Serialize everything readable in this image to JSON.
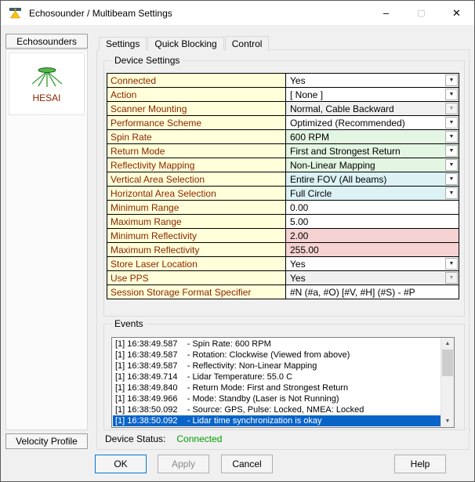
{
  "palette": {
    "accent": "#0078D7",
    "label_bg": "#FFFFD9",
    "label_text": "#8B2500",
    "green_bg": "#E3F5E3",
    "cyan_bg": "#DCF2F5",
    "pink_bg": "#F6D2D2",
    "disabled_bg": "#F0F0F0",
    "white_bg": "#FFFFFF",
    "selection_bg": "#0A64C8",
    "status_color": "#00A000",
    "grid_border": "#000000"
  },
  "window": {
    "title": "Echosounder / Multibeam Settings",
    "minimize_glyph": "–",
    "maximize_glyph": "▢",
    "close_glyph": "✕"
  },
  "sidebar": {
    "header": "Echosounders",
    "device": "HESAI",
    "footer": "Velocity Profile"
  },
  "tabs": [
    {
      "label": "Settings",
      "active": false
    },
    {
      "label": "Quick Blocking",
      "active": false
    },
    {
      "label": "Control",
      "active": true
    }
  ],
  "device_settings": {
    "title": "Device Settings",
    "rows": [
      {
        "label": "Connected",
        "value": "Yes",
        "control": "dropdown",
        "bg": "white",
        "disabled": false
      },
      {
        "label": "Action",
        "value": "[ None ]",
        "control": "dropdown",
        "bg": "white",
        "disabled": false
      },
      {
        "label": "Scanner Mounting",
        "value": "Normal, Cable Backward",
        "control": "dropdown",
        "bg": "disabled",
        "disabled": true
      },
      {
        "label": "Performance Scheme",
        "value": "Optimized (Recommended)",
        "control": "dropdown",
        "bg": "white",
        "disabled": false
      },
      {
        "label": "Spin Rate",
        "value": "600 RPM",
        "control": "dropdown",
        "bg": "green",
        "disabled": false
      },
      {
        "label": "Return Mode",
        "value": "First and Strongest Return",
        "control": "dropdown",
        "bg": "green",
        "disabled": false
      },
      {
        "label": "Reflectivity Mapping",
        "value": "Non-Linear Mapping",
        "control": "dropdown",
        "bg": "green",
        "disabled": false
      },
      {
        "label": "Vertical Area Selection",
        "value": "Entire FOV (All beams)",
        "control": "dropdown",
        "bg": "cyan",
        "disabled": false
      },
      {
        "label": "Horizontal Area Selection",
        "value": "Full Circle",
        "control": "dropdown",
        "bg": "cyan",
        "disabled": false
      },
      {
        "label": "Minimum Range",
        "value": "0.00",
        "control": "input",
        "bg": "white",
        "disabled": false
      },
      {
        "label": "Maximum Range",
        "value": "5.00",
        "control": "input",
        "bg": "white",
        "disabled": false
      },
      {
        "label": "Minimum Reflectivity",
        "value": "2.00",
        "control": "input",
        "bg": "pink",
        "disabled": false
      },
      {
        "label": "Maximum Reflectivity",
        "value": "255.00",
        "control": "input",
        "bg": "pink",
        "disabled": false
      },
      {
        "label": "Store Laser Location",
        "value": "Yes",
        "control": "dropdown",
        "bg": "white",
        "disabled": false
      },
      {
        "label": "Use PPS",
        "value": "Yes",
        "control": "dropdown",
        "bg": "disabled",
        "disabled": true
      },
      {
        "label": "Session Storage Format Specifier",
        "value": "#N (#a, #O) [#V, #H] (#S) - #P",
        "control": "input",
        "bg": "white",
        "disabled": false
      }
    ]
  },
  "events": {
    "title": "Events",
    "selected_index": 7,
    "items": [
      "[1] 16:38:49.587    - Spin Rate: 600 RPM",
      "[1] 16:38:49.587    - Rotation: Clockwise (Viewed from above)",
      "[1] 16:38:49.587    - Reflectivity: Non-Linear Mapping",
      "[1] 16:38:49.714    - Lidar Temperature: 55.0 C",
      "[1] 16:38:49.840    - Return Mode: First and Strongest Return",
      "[1] 16:38:49.966    - Mode: Standby (Laser is Not Running)",
      "[1] 16:38:50.092    - Source: GPS, Pulse: Locked, NMEA: Locked",
      "[1] 16:38:50.092    - Lidar time synchronization is okay"
    ]
  },
  "status": {
    "label": "Device Status:",
    "value": "Connected"
  },
  "buttons": {
    "ok": "OK",
    "apply": "Apply",
    "cancel": "Cancel",
    "help": "Help",
    "apply_disabled": true
  },
  "icons": {
    "combo_arrow": "▼",
    "scroll_up": "▲",
    "scroll_down": "▼"
  }
}
